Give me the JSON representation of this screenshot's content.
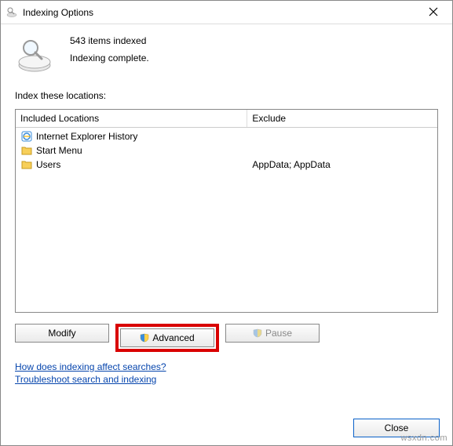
{
  "titlebar": {
    "title": "Indexing Options"
  },
  "status": {
    "count_line": "543 items indexed",
    "complete_line": "Indexing complete."
  },
  "locations_label": "Index these locations:",
  "columns": {
    "included": "Included Locations",
    "exclude": "Exclude"
  },
  "rows": [
    {
      "included": "Internet Explorer History",
      "exclude": "",
      "icon": "ie"
    },
    {
      "included": "Start Menu",
      "exclude": "",
      "icon": "folder"
    },
    {
      "included": "Users",
      "exclude": "AppData; AppData",
      "icon": "folder"
    }
  ],
  "buttons": {
    "modify": "Modify",
    "advanced": "Advanced",
    "pause": "Pause",
    "close": "Close"
  },
  "links": {
    "affect": "How does indexing affect searches?",
    "troubleshoot": "Troubleshoot search and indexing"
  },
  "watermark": "wsxdn.com"
}
